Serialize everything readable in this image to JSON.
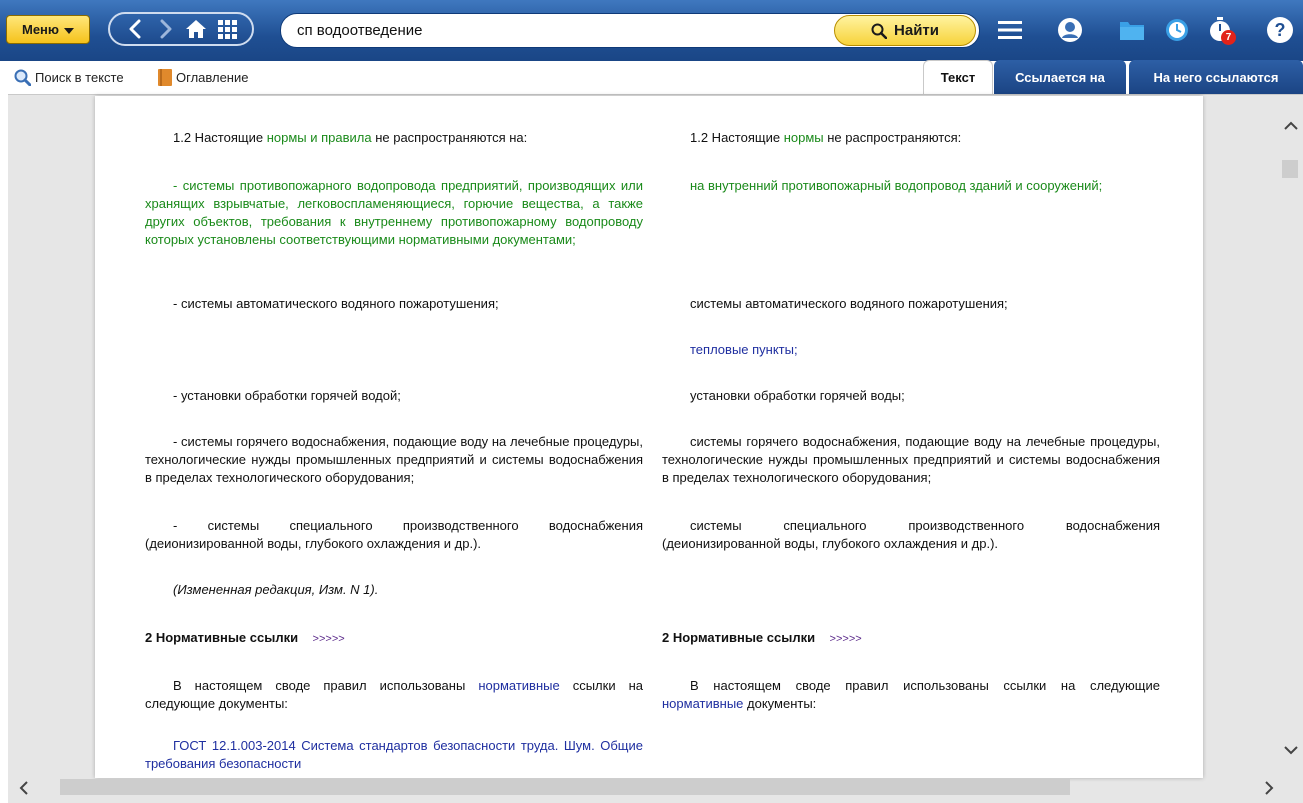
{
  "topbar": {
    "menu_label": "Меню",
    "search_value": "сп водоотведение",
    "find_label": "Найти",
    "notifications_count": "7"
  },
  "toolbar": {
    "search_in_text": "Поиск в тексте",
    "contents": "Оглавление"
  },
  "tabs": [
    {
      "label": "Текст",
      "active": true
    },
    {
      "label": "Ссылается на",
      "active": false
    },
    {
      "label": "На него ссылаются",
      "active": false
    }
  ],
  "colors": {
    "topbar": "#1f4f93",
    "accent_yellow": "#f5c21b",
    "link_green": "#1a8a1a",
    "link_blue": "#1f2fa0"
  },
  "left": {
    "p1_prefix": "1.2 Настоящие ",
    "p1_link": "нормы и правила",
    "p1_suffix": " не распространяются на:",
    "p2": "- системы противопожарного водопровода предприятий, производящих или хранящих взрывчатые, легковоспламеняющиеся, горючие вещества, а также других объектов, требования к внутреннему противопожарному водопроводу которых установлены соответствующими нормативными документами;",
    "p3": "- системы автоматического водяного пожаротушения;",
    "p4": "- установки обработки горячей водой;",
    "p5": "- системы горячего водоснабжения, подающие воду на лечебные процедуры, технологические нужды промышленных предприятий и системы водоснабжения в пределах технологического оборудования;",
    "p6": "- системы специального производственного водоснабжения (деионизированной воды, глубокого охлаждения и др.).",
    "p7": "(Измененная редакция, Изм. N 1).",
    "h2": "2 Нормативные ссылки",
    "h2_link": ">>>>>",
    "p8_prefix": "В настоящем своде правил использованы ",
    "p8_link": "нормативные",
    "p8_suffix": " ссылки на следующие документы:",
    "p9": "ГОСТ 12.1.003-2014 Система стандартов безопасности труда. Шум. Общие требования безопасности"
  },
  "right": {
    "p1_prefix": "1.2 Настоящие ",
    "p1_link": "нормы",
    "p1_suffix": " не распространяются:",
    "p2": "на внутренний противопожарный водопровод зданий и сооружений;",
    "p3": "системы автоматического водяного пожаротушения;",
    "p3b": "тепловые пункты;",
    "p4": "установки обработки горячей воды;",
    "p5": "системы горячего водоснабжения, подающие воду на лечебные процедуры, технологические нужды промышленных предприятий и системы водоснабжения в пределах технологического оборудования;",
    "p6": "системы специального производственного водоснабжения (деионизированной воды, глубокого охлаждения и др.).",
    "h2": "2 Нормативные ссылки",
    "h2_link": ">>>>>",
    "p8_prefix": "В настоящем своде правил использованы ссылки на следующие ",
    "p8_link": "нормативные",
    "p8_suffix": " документы:"
  }
}
